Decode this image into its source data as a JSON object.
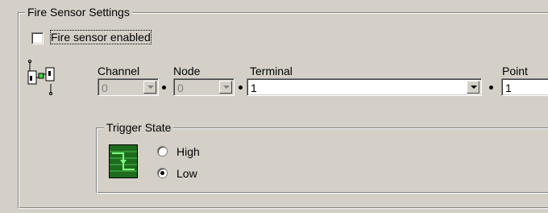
{
  "fire_settings": {
    "group_title": "Fire Sensor Settings",
    "enabled_label": "Fire sensor enabled",
    "enabled_checked": false,
    "columns": {
      "channel": "Channel",
      "node": "Node",
      "terminal": "Terminal",
      "point": "Point"
    },
    "fields": {
      "channel_value": "0",
      "node_value": "0",
      "terminal_value": "1",
      "point_value": "1"
    },
    "trigger": {
      "group_title": "Trigger State",
      "high_label": "High",
      "low_label": "Low",
      "selected": "Low"
    },
    "icons": {
      "device": "device-network-icon",
      "trigger": "trigger-edge-icon"
    }
  }
}
